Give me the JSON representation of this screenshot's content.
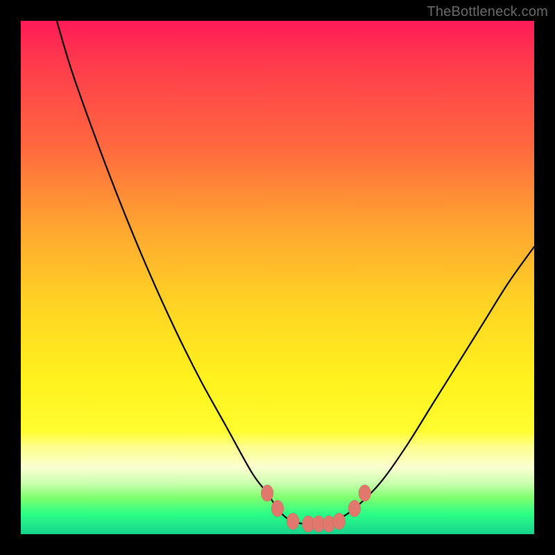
{
  "watermark": "TheBottleneck.com",
  "chart_data": {
    "type": "line",
    "title": "",
    "xlabel": "",
    "ylabel": "",
    "xlim": [
      0,
      100
    ],
    "ylim": [
      0,
      100
    ],
    "grid": false,
    "legend": false,
    "series": [
      {
        "name": "bottleneck-curve",
        "x": [
          7,
          10,
          15,
          20,
          25,
          30,
          35,
          40,
          45,
          48,
          50,
          52,
          55,
          58,
          60,
          62,
          65,
          70,
          75,
          80,
          85,
          90,
          95,
          100
        ],
        "y": [
          100,
          90,
          76,
          63,
          51,
          40,
          30,
          21,
          12,
          8,
          5,
          3,
          2,
          2,
          2,
          3,
          5,
          10,
          17,
          25,
          33,
          41,
          49,
          56
        ]
      }
    ],
    "markers": {
      "name": "highlighted-points",
      "points": [
        {
          "x": 48,
          "y": 8
        },
        {
          "x": 50,
          "y": 5
        },
        {
          "x": 53,
          "y": 2.5
        },
        {
          "x": 56,
          "y": 2
        },
        {
          "x": 58,
          "y": 2
        },
        {
          "x": 60,
          "y": 2
        },
        {
          "x": 62,
          "y": 2.5
        },
        {
          "x": 65,
          "y": 5
        },
        {
          "x": 67,
          "y": 8
        }
      ]
    },
    "gradient_stops": [
      {
        "pos": 0,
        "color": "#ff1a58"
      },
      {
        "pos": 25,
        "color": "#ff6a3e"
      },
      {
        "pos": 55,
        "color": "#ffd324"
      },
      {
        "pos": 83,
        "color": "#fdff8d"
      },
      {
        "pos": 93,
        "color": "#7dff6e"
      },
      {
        "pos": 100,
        "color": "#17d38d"
      }
    ]
  }
}
